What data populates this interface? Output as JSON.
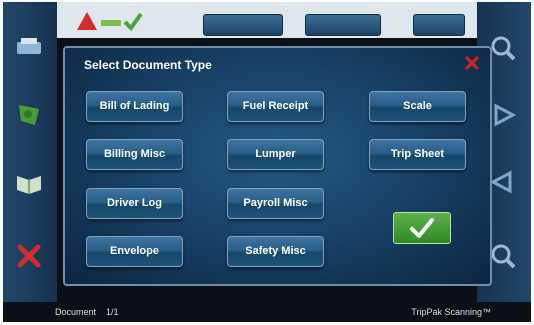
{
  "dialog": {
    "title": "Select Document Type",
    "buttons": [
      "Bill of Lading",
      "Fuel Receipt",
      "Scale",
      "Billing Misc",
      "Lumper",
      "Trip Sheet",
      "Driver Log",
      "Payroll Misc",
      "Envelope",
      "Safety Misc"
    ],
    "close_icon": "close-x-icon",
    "confirm_icon": "checkmark-icon"
  },
  "status": {
    "document_label": "Document",
    "document_count": "1/1",
    "brand": "TripPak Scanning™"
  },
  "colors": {
    "dialog_bg": "#163e62",
    "button_bg": "#245a84",
    "ok_green": "#3e9a32",
    "close_red": "#e02020"
  }
}
